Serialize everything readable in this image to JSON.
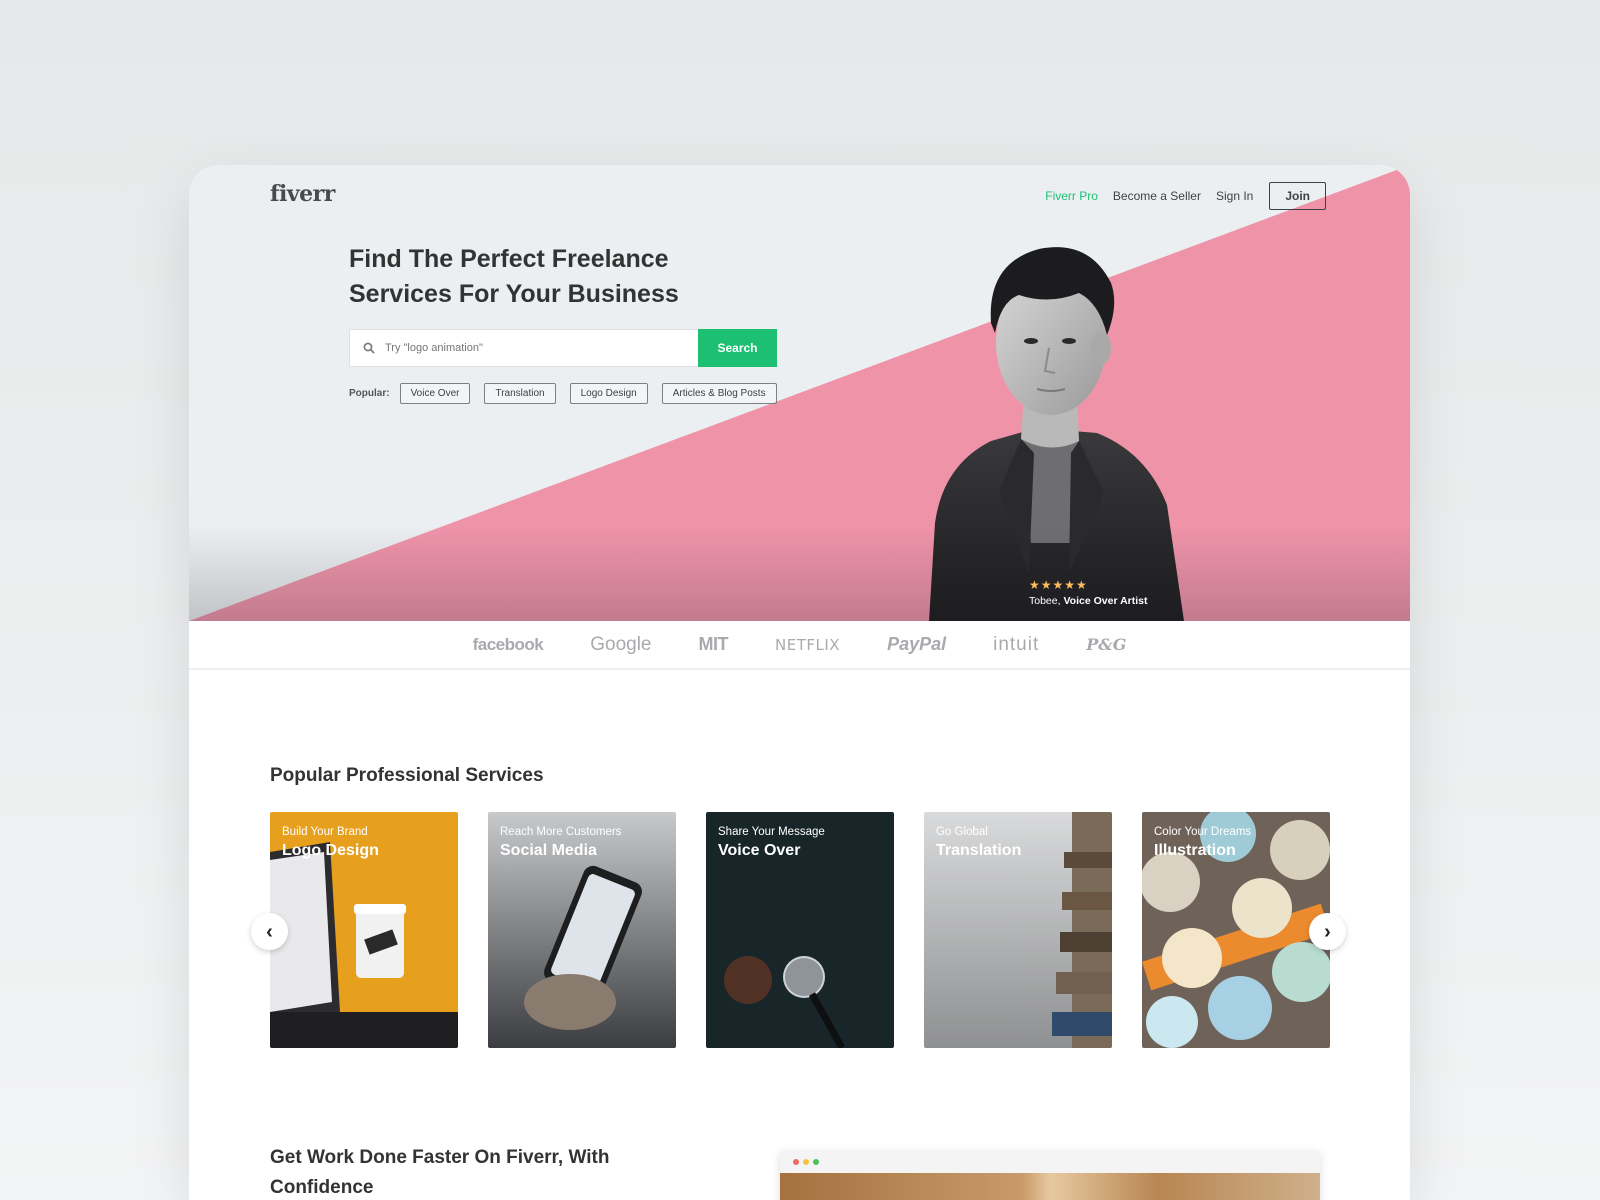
{
  "header": {
    "logo": "fiverr",
    "nav": {
      "pro": "Fiverr Pro",
      "become_seller": "Become a Seller",
      "sign_in": "Sign In",
      "join": "Join"
    }
  },
  "hero": {
    "headline": "Find The Perfect Freelance Services For Your Business",
    "search": {
      "placeholder": "Try \"logo animation\"",
      "button": "Search"
    },
    "popular_label": "Popular:",
    "popular_tags": [
      "Voice Over",
      "Translation",
      "Logo Design",
      "Articles & Blog Posts"
    ],
    "featured": {
      "stars": "★★★★★",
      "name": "Tobee,",
      "role": "Voice Over Artist"
    }
  },
  "trusted_by": [
    "facebook",
    "Google",
    "MIT",
    "NETFLIX",
    "PayPal",
    "intuit",
    "P&G"
  ],
  "services": {
    "title": "Popular Professional Services",
    "cards": [
      {
        "subtitle": "Build Your Brand",
        "name": "Logo Design"
      },
      {
        "subtitle": "Reach More Customers",
        "name": "Social Media"
      },
      {
        "subtitle": "Share Your Message",
        "name": "Voice Over"
      },
      {
        "subtitle": "Go Global",
        "name": "Translation"
      },
      {
        "subtitle": "Color Your Dreams",
        "name": "Illustration"
      }
    ],
    "prev_icon": "‹",
    "next_icon": "›"
  },
  "section2": {
    "title": "Get Work Done Faster On Fiverr, With Confidence"
  },
  "colors": {
    "brand_green": "#1dbf73",
    "hero_pink": "#ef93a9",
    "hero_bg": "#eceff1"
  }
}
